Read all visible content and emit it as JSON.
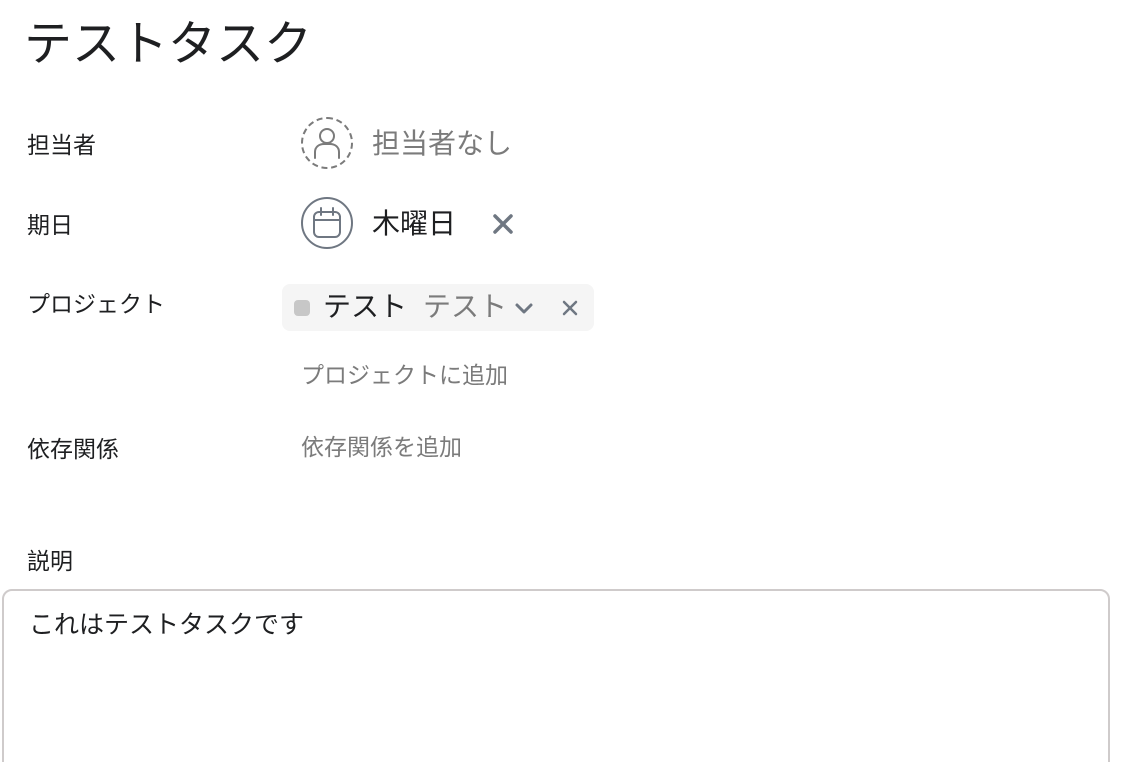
{
  "task": {
    "title": "テストタスク"
  },
  "fields": {
    "assignee": {
      "label": "担当者",
      "value": "担当者なし",
      "icon": "user-icon"
    },
    "due_date": {
      "label": "期日",
      "value": "木曜日",
      "icon": "calendar-icon",
      "clear_icon": "close-icon"
    },
    "projects": {
      "label": "プロジェクト",
      "items": [
        {
          "name": "テスト",
          "section": "テスト",
          "swatch_color": "#c7c7c7"
        }
      ],
      "add_label": "プロジェクトに追加"
    },
    "dependencies": {
      "label": "依存関係",
      "add_label": "依存関係を追加"
    }
  },
  "description": {
    "label": "説明",
    "value": "これはテストタスクです"
  },
  "colors": {
    "text": "#1e1f21",
    "muted_text": "#7b7b7b",
    "chip_background": "#f5f5f5",
    "border": "#cfcbcb"
  }
}
